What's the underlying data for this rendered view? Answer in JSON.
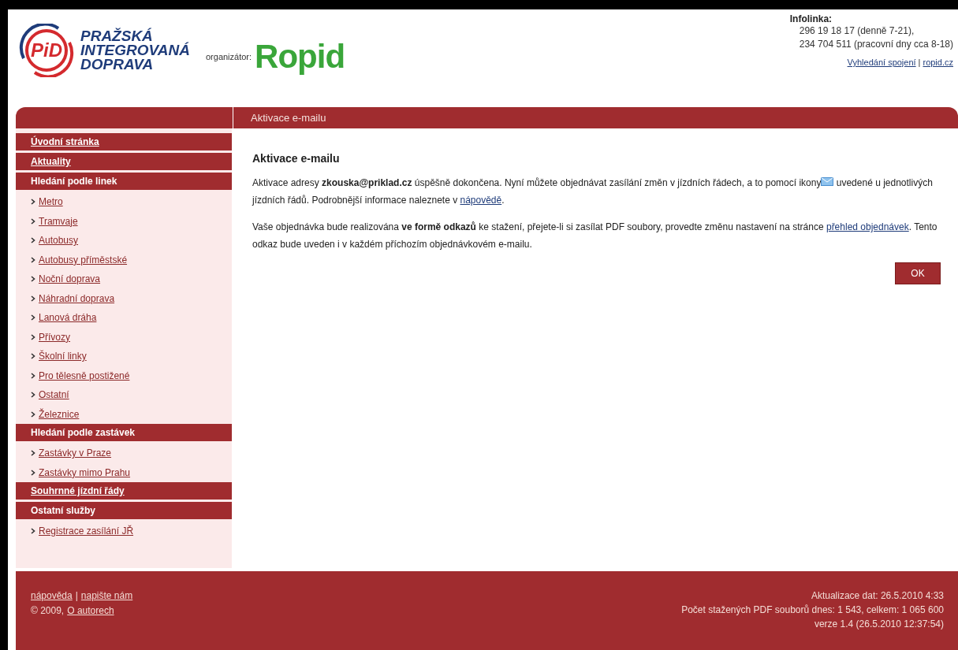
{
  "header": {
    "logo_lines": [
      "PRAŽSKÁ",
      "INTEGROVANÁ",
      "DOPRAVA"
    ],
    "logo_mark": "PiD",
    "organizer_label": "organizátor:",
    "organizer_logo": "Ropid",
    "infoline_title": "Infolinka:",
    "infoline_lines": [
      "296 19 18 17 (denně 7-21),",
      "234 704 511 (pracovní dny cca 8-18)"
    ],
    "links": [
      "Vyhledání spojení",
      "ropid.cz"
    ],
    "separator": "|"
  },
  "title_bar": "Aktivace e-mailu",
  "sidebar": {
    "items": [
      {
        "kind": "link-header",
        "label": "Úvodní stránka"
      },
      {
        "kind": "link-header",
        "label": "Aktuality"
      },
      {
        "kind": "header",
        "label": "Hledání podle linek"
      },
      {
        "kind": "item",
        "label": "Metro"
      },
      {
        "kind": "item",
        "label": "Tramvaje"
      },
      {
        "kind": "item",
        "label": "Autobusy"
      },
      {
        "kind": "item",
        "label": "Autobusy příměstské"
      },
      {
        "kind": "item",
        "label": "Noční doprava"
      },
      {
        "kind": "item",
        "label": "Náhradní doprava"
      },
      {
        "kind": "item",
        "label": "Lanová dráha"
      },
      {
        "kind": "item",
        "label": "Přívozy"
      },
      {
        "kind": "item",
        "label": "Školní linky"
      },
      {
        "kind": "item",
        "label": "Pro tělesně postižené"
      },
      {
        "kind": "item",
        "label": "Ostatní"
      },
      {
        "kind": "item",
        "label": "Železnice"
      },
      {
        "kind": "header",
        "label": "Hledání podle zastávek"
      },
      {
        "kind": "item",
        "label": "Zastávky v Praze"
      },
      {
        "kind": "item",
        "label": "Zastávky mimo Prahu"
      },
      {
        "kind": "link-header",
        "label": "Souhrnné jízdní řády"
      },
      {
        "kind": "header",
        "label": "Ostatní služby"
      },
      {
        "kind": "item",
        "label": "Registrace zasílání JŘ"
      }
    ]
  },
  "content": {
    "heading": "Aktivace e-mailu",
    "paragraphs": [
      [
        {
          "kind": "text",
          "text": "Aktivace adresy    **zkouska@priklad.cz**    úspěšně dokončena. Nyní můžete objednávat zasílání změn v jízdních řádech, a to pomocí ikony"
        },
        {
          "kind": "icon"
        },
        {
          "kind": "text",
          "text": " uvedené u jednotlivých jízdních řádů. Podrobnější informace naleznete v "
        },
        {
          "kind": "link",
          "text": "nápovědě"
        },
        {
          "kind": "text",
          "text": "."
        }
      ],
      [
        {
          "kind": "text",
          "text": "Vaše objednávka bude realizována **ve formě odkazů** ke stažení, přejete-li si zasílat PDF soubory, provedte změnu nastavení na stránce "
        },
        {
          "kind": "link",
          "text": "přehled objednávek"
        },
        {
          "kind": "text",
          "text": ". Tento odkaz bude uveden i v každém příchozím objednávkovém e-mailu."
        }
      ]
    ],
    "ok_button": "OK"
  },
  "footer": {
    "links": [
      "nápověda",
      "napište nám"
    ],
    "separator": "|",
    "copyright": "© 2009,",
    "about_link": "O autorech",
    "right_lines": [
      "Aktualizace dat: 26.5.2010 4:33",
      "Počet stažených PDF souborů dnes: 1 543, celkem: 1 065 600",
      "verze 1.4 (26.5.2010 12:37:54)"
    ]
  }
}
